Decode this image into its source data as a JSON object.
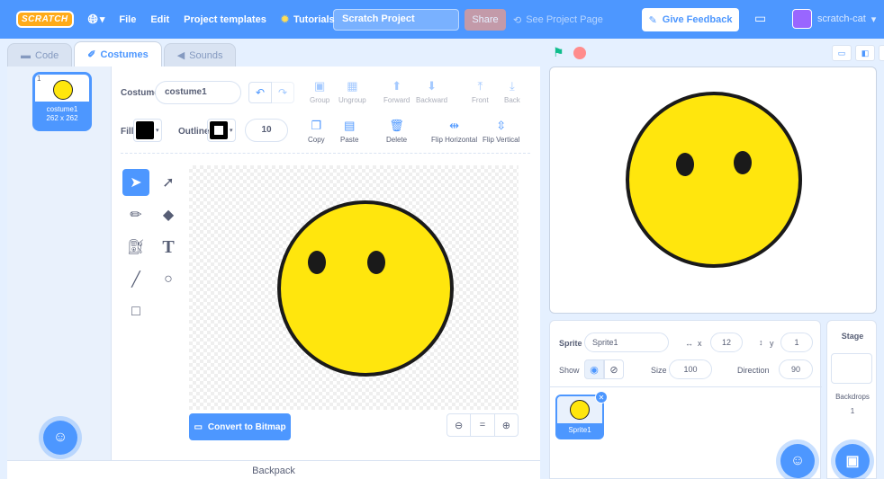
{
  "menubar": {
    "logo": "SCRATCH",
    "globe_caret": "▾",
    "file": "File",
    "edit": "Edit",
    "templates": "Project templates",
    "tutorials": "Tutorials",
    "project_title": "Scratch Project",
    "share": "Share",
    "see_project": "See Project Page",
    "feedback": "Give Feedback",
    "username": "scratch-cat"
  },
  "tabs": [
    {
      "label": "Code",
      "icon": "code-icon"
    },
    {
      "label": "Costumes",
      "icon": "brush-icon"
    },
    {
      "label": "Sounds",
      "icon": "speaker-icon"
    }
  ],
  "costume_list": {
    "number": "1",
    "name": "costume1",
    "size": "262 x 262"
  },
  "editor": {
    "costume_label": "Costume",
    "costume_name": "costume1",
    "group": "Group",
    "ungroup": "Ungroup",
    "forward": "Forward",
    "backward": "Backward",
    "front": "Front",
    "back": "Back",
    "fill_label": "Fill",
    "fill_color": "#000000",
    "outline_label": "Outline",
    "outline_color": "#000000",
    "outline_width": "10",
    "copy": "Copy",
    "paste": "Paste",
    "delete": "Delete",
    "flip_h": "Flip Horizontal",
    "flip_v": "Flip Vertical",
    "convert": "Convert to Bitmap",
    "zoom_out": "−",
    "zoom_reset": "=",
    "zoom_in": "+"
  },
  "face": {
    "fill": "#ffe60d",
    "stroke": "#1a1a1a"
  },
  "backpack": "Backpack",
  "sprite": {
    "sprite_label": "Sprite",
    "name": "Sprite1",
    "x_label": "x",
    "x": "12",
    "y_label": "y",
    "y": "1",
    "show_label": "Show",
    "size_label": "Size",
    "size": "100",
    "direction_label": "Direction",
    "direction": "90",
    "tile_name": "Sprite1"
  },
  "stage_panel": {
    "title": "Stage",
    "backdrops_label": "Backdrops",
    "backdrops_count": "1"
  }
}
